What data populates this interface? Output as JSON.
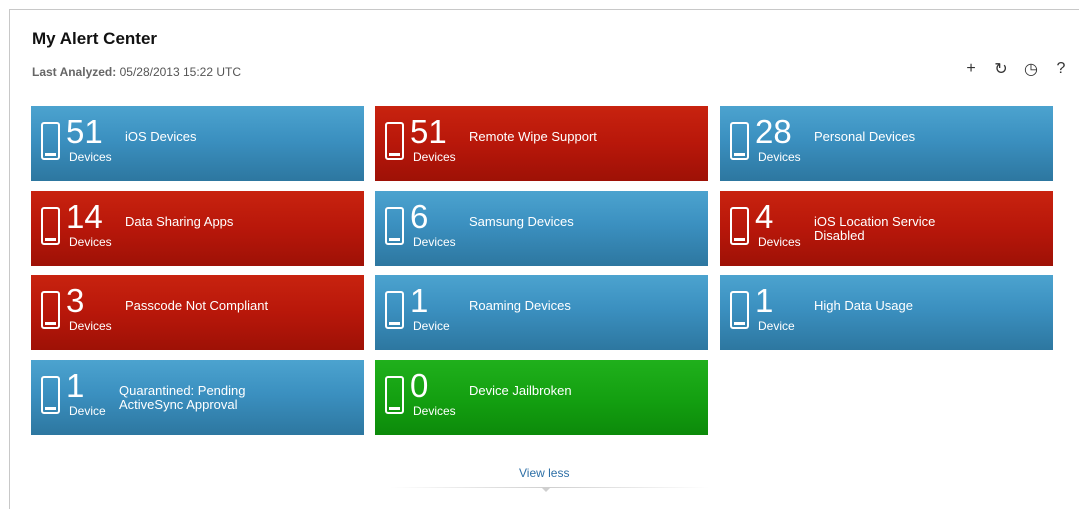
{
  "header": {
    "title": "My Alert Center",
    "last_analyzed_label": "Last Analyzed:",
    "last_analyzed_value": "05/28/2013 15:22 UTC"
  },
  "toolbar": {
    "add": "+",
    "refresh": "↻",
    "history": "◷",
    "help": "?"
  },
  "colors": {
    "blue": "#3b90c0",
    "red": "#b8170a",
    "green": "#139f10",
    "link": "#2d6fa6"
  },
  "tiles": [
    {
      "count": "51",
      "unit": "Devices",
      "label": "iOS Devices",
      "color": "blue",
      "icon": "phone-icon"
    },
    {
      "count": "51",
      "unit": "Devices",
      "label": "Remote Wipe Support",
      "color": "red",
      "icon": "phone-icon"
    },
    {
      "count": "28",
      "unit": "Devices",
      "label": "Personal Devices",
      "color": "blue",
      "icon": "phone-icon"
    },
    {
      "count": "14",
      "unit": "Devices",
      "label": "Data Sharing Apps",
      "color": "red",
      "icon": "phone-icon"
    },
    {
      "count": "6",
      "unit": "Devices",
      "label": "Samsung Devices",
      "color": "blue",
      "icon": "phone-icon"
    },
    {
      "count": "4",
      "unit": "Devices",
      "label": "iOS Location Service Disabled",
      "color": "red",
      "icon": "phone-icon"
    },
    {
      "count": "3",
      "unit": "Devices",
      "label": "Passcode Not Compliant",
      "color": "red",
      "icon": "phone-icon"
    },
    {
      "count": "1",
      "unit": "Device",
      "label": "Roaming Devices",
      "color": "blue",
      "icon": "phone-icon"
    },
    {
      "count": "1",
      "unit": "Device",
      "label": "High Data Usage",
      "color": "blue",
      "icon": "phone-icon"
    },
    {
      "count": "1",
      "unit": "Device",
      "label": "Quarantined: Pending ActiveSync Approval",
      "color": "blue",
      "icon": "phone-icon"
    },
    {
      "count": "0",
      "unit": "Devices",
      "label": "Device Jailbroken",
      "color": "green",
      "icon": "phone-icon"
    }
  ],
  "footer": {
    "view_less": "View less"
  }
}
